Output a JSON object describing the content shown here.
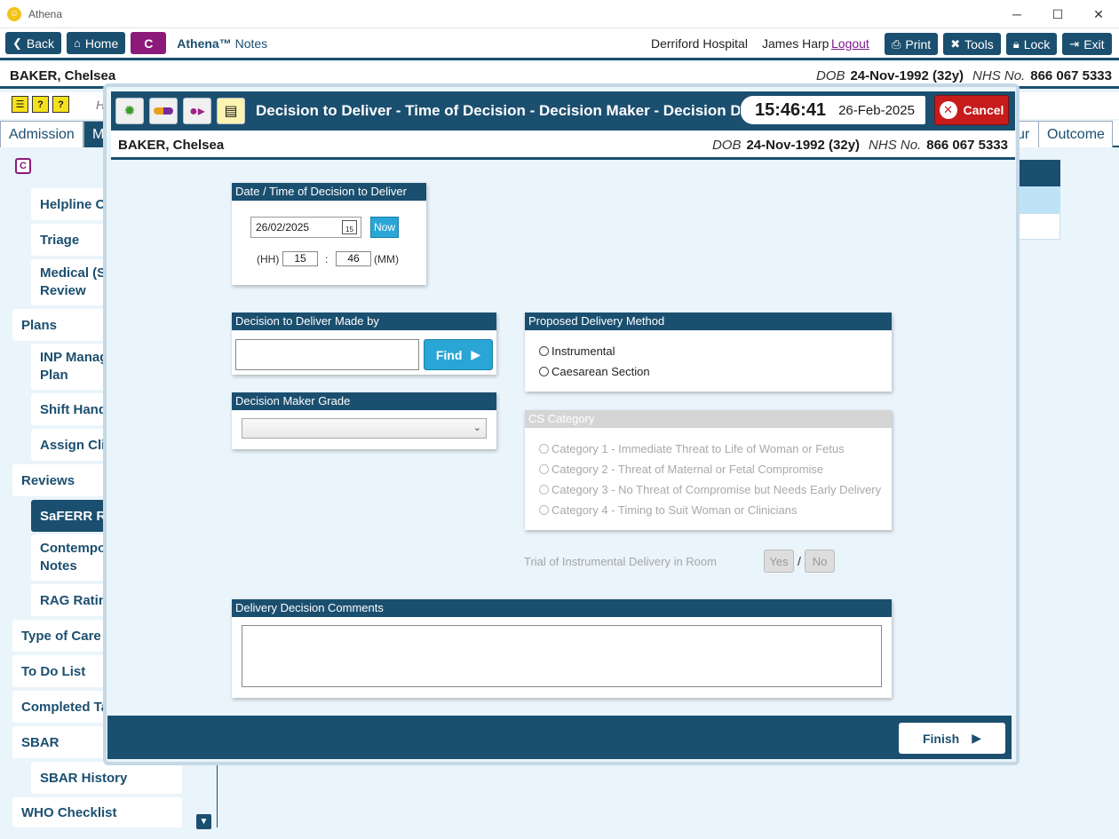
{
  "window": {
    "title": "Athena",
    "minimize": "─",
    "maximize": "☐",
    "close": "✕"
  },
  "toolbar": {
    "back": "Back",
    "home": "Home",
    "c": "C",
    "app_brand": "Athena™",
    "app_module": "Notes",
    "hospital": "Derriford Hospital",
    "user": "James Harp",
    "logout": "Logout",
    "print": "Print",
    "tools": "Tools",
    "lock": "Lock",
    "exit": "Exit"
  },
  "patient": {
    "name": "BAKER, Chelsea",
    "dob_label": "DOB",
    "dob": "24-Nov-1992 (32y)",
    "nhs_label": "NHS No.",
    "nhs": "866 067 5333"
  },
  "bg_tabs": {
    "admission": "Admission",
    "m": "M",
    "ur": "ur",
    "outcome": "Outcome",
    "h": "H"
  },
  "sidebar": {
    "c": "C",
    "items": [
      {
        "label": "Helpline Co"
      },
      {
        "label": "Triage"
      },
      {
        "label": "Medical (Sa"
      },
      {
        "label": "Review"
      },
      {
        "label": "Plans"
      },
      {
        "label": "INP Manag"
      },
      {
        "label": "Plan"
      },
      {
        "label": "Shift Hand"
      },
      {
        "label": "Assign Clin"
      },
      {
        "label": "Reviews"
      },
      {
        "label": "SaFERR Re"
      },
      {
        "label": "Contempo"
      },
      {
        "label": "Notes"
      },
      {
        "label": "RAG Rating"
      },
      {
        "label": "Type of Care"
      },
      {
        "label": "To Do List"
      },
      {
        "label": "Completed Ta"
      },
      {
        "label": "SBAR"
      },
      {
        "label": "SBAR History"
      },
      {
        "label": "WHO Checklist"
      }
    ]
  },
  "modal": {
    "title": "Decision to Deliver - Time of Decision - Decision Maker - Decision Details",
    "clock_time": "15:46:41",
    "clock_date": "26-Feb-2025",
    "cancel": "Cancel",
    "date_panel": {
      "title": "Date / Time of Decision to Deliver",
      "date_value": "26/02/2025",
      "cal_day": "15",
      "now": "Now",
      "hh_label": "(HH)",
      "hh_value": "15",
      "colon": ":",
      "mm_value": "46",
      "mm_label": "(MM)"
    },
    "made_by_panel": {
      "title": "Decision to Deliver Made by",
      "find": "Find"
    },
    "grade_panel": {
      "title": "Decision Maker Grade"
    },
    "method_panel": {
      "title": "Proposed Delivery Method",
      "options": [
        "Instrumental",
        "Caesarean Section"
      ]
    },
    "cs_panel": {
      "title": "CS Category",
      "options": [
        "Category 1 - Immediate Threat to Life of Woman or Fetus",
        "Category 2 - Threat of Maternal or Fetal Compromise",
        "Category 3 - No Threat of Compromise but Needs Early Delivery",
        "Category 4 - Timing to Suit Woman or Clinicians"
      ]
    },
    "trial": {
      "label": "Trial of Instrumental Delivery in Room",
      "yes": "Yes",
      "slash": "/",
      "no": "No"
    },
    "comments_panel": {
      "title": "Delivery Decision Comments"
    },
    "finish": "Finish"
  },
  "colors": {
    "primary": "#1b4f6f",
    "accent": "#2aa6d6",
    "cancel": "#c81b1b",
    "brand_c": "#8b1a7a"
  }
}
